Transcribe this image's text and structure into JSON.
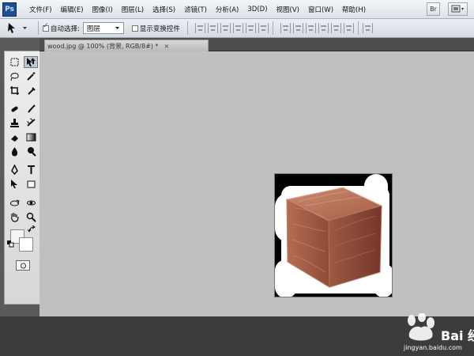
{
  "app": {
    "logo": "Ps"
  },
  "menu": {
    "items": [
      "文件(F)",
      "编辑(E)",
      "图像(I)",
      "图层(L)",
      "选择(S)",
      "滤镜(T)",
      "分析(A)",
      "3D(D)",
      "视图(V)",
      "窗口(W)",
      "帮助(H)"
    ],
    "bridge_label": "Br"
  },
  "options": {
    "auto_select_label": "自动选择:",
    "auto_select_value": "图层",
    "show_transform_label": "显示变换控件"
  },
  "document": {
    "tab_title": "wood.jpg @ 100% (背景, RGB/8#) *",
    "close_label": "×"
  },
  "toolbox": {
    "icons": [
      "marquee-icon",
      "move-icon",
      "lasso-icon",
      "magic-wand-icon",
      "crop-icon",
      "eyedropper-icon",
      "spot-healing-icon",
      "brush-icon",
      "clone-stamp-icon",
      "history-brush-icon",
      "eraser-icon",
      "gradient-icon",
      "blur-icon",
      "dodge-icon",
      "pen-icon",
      "type-icon",
      "path-selection-icon",
      "shape-icon",
      "3d-rotate-icon",
      "3d-orbit-icon",
      "hand-icon",
      "zoom-icon"
    ]
  },
  "watermark": {
    "brand": "Bai 经验",
    "url": "jingyan.baidu.com"
  }
}
